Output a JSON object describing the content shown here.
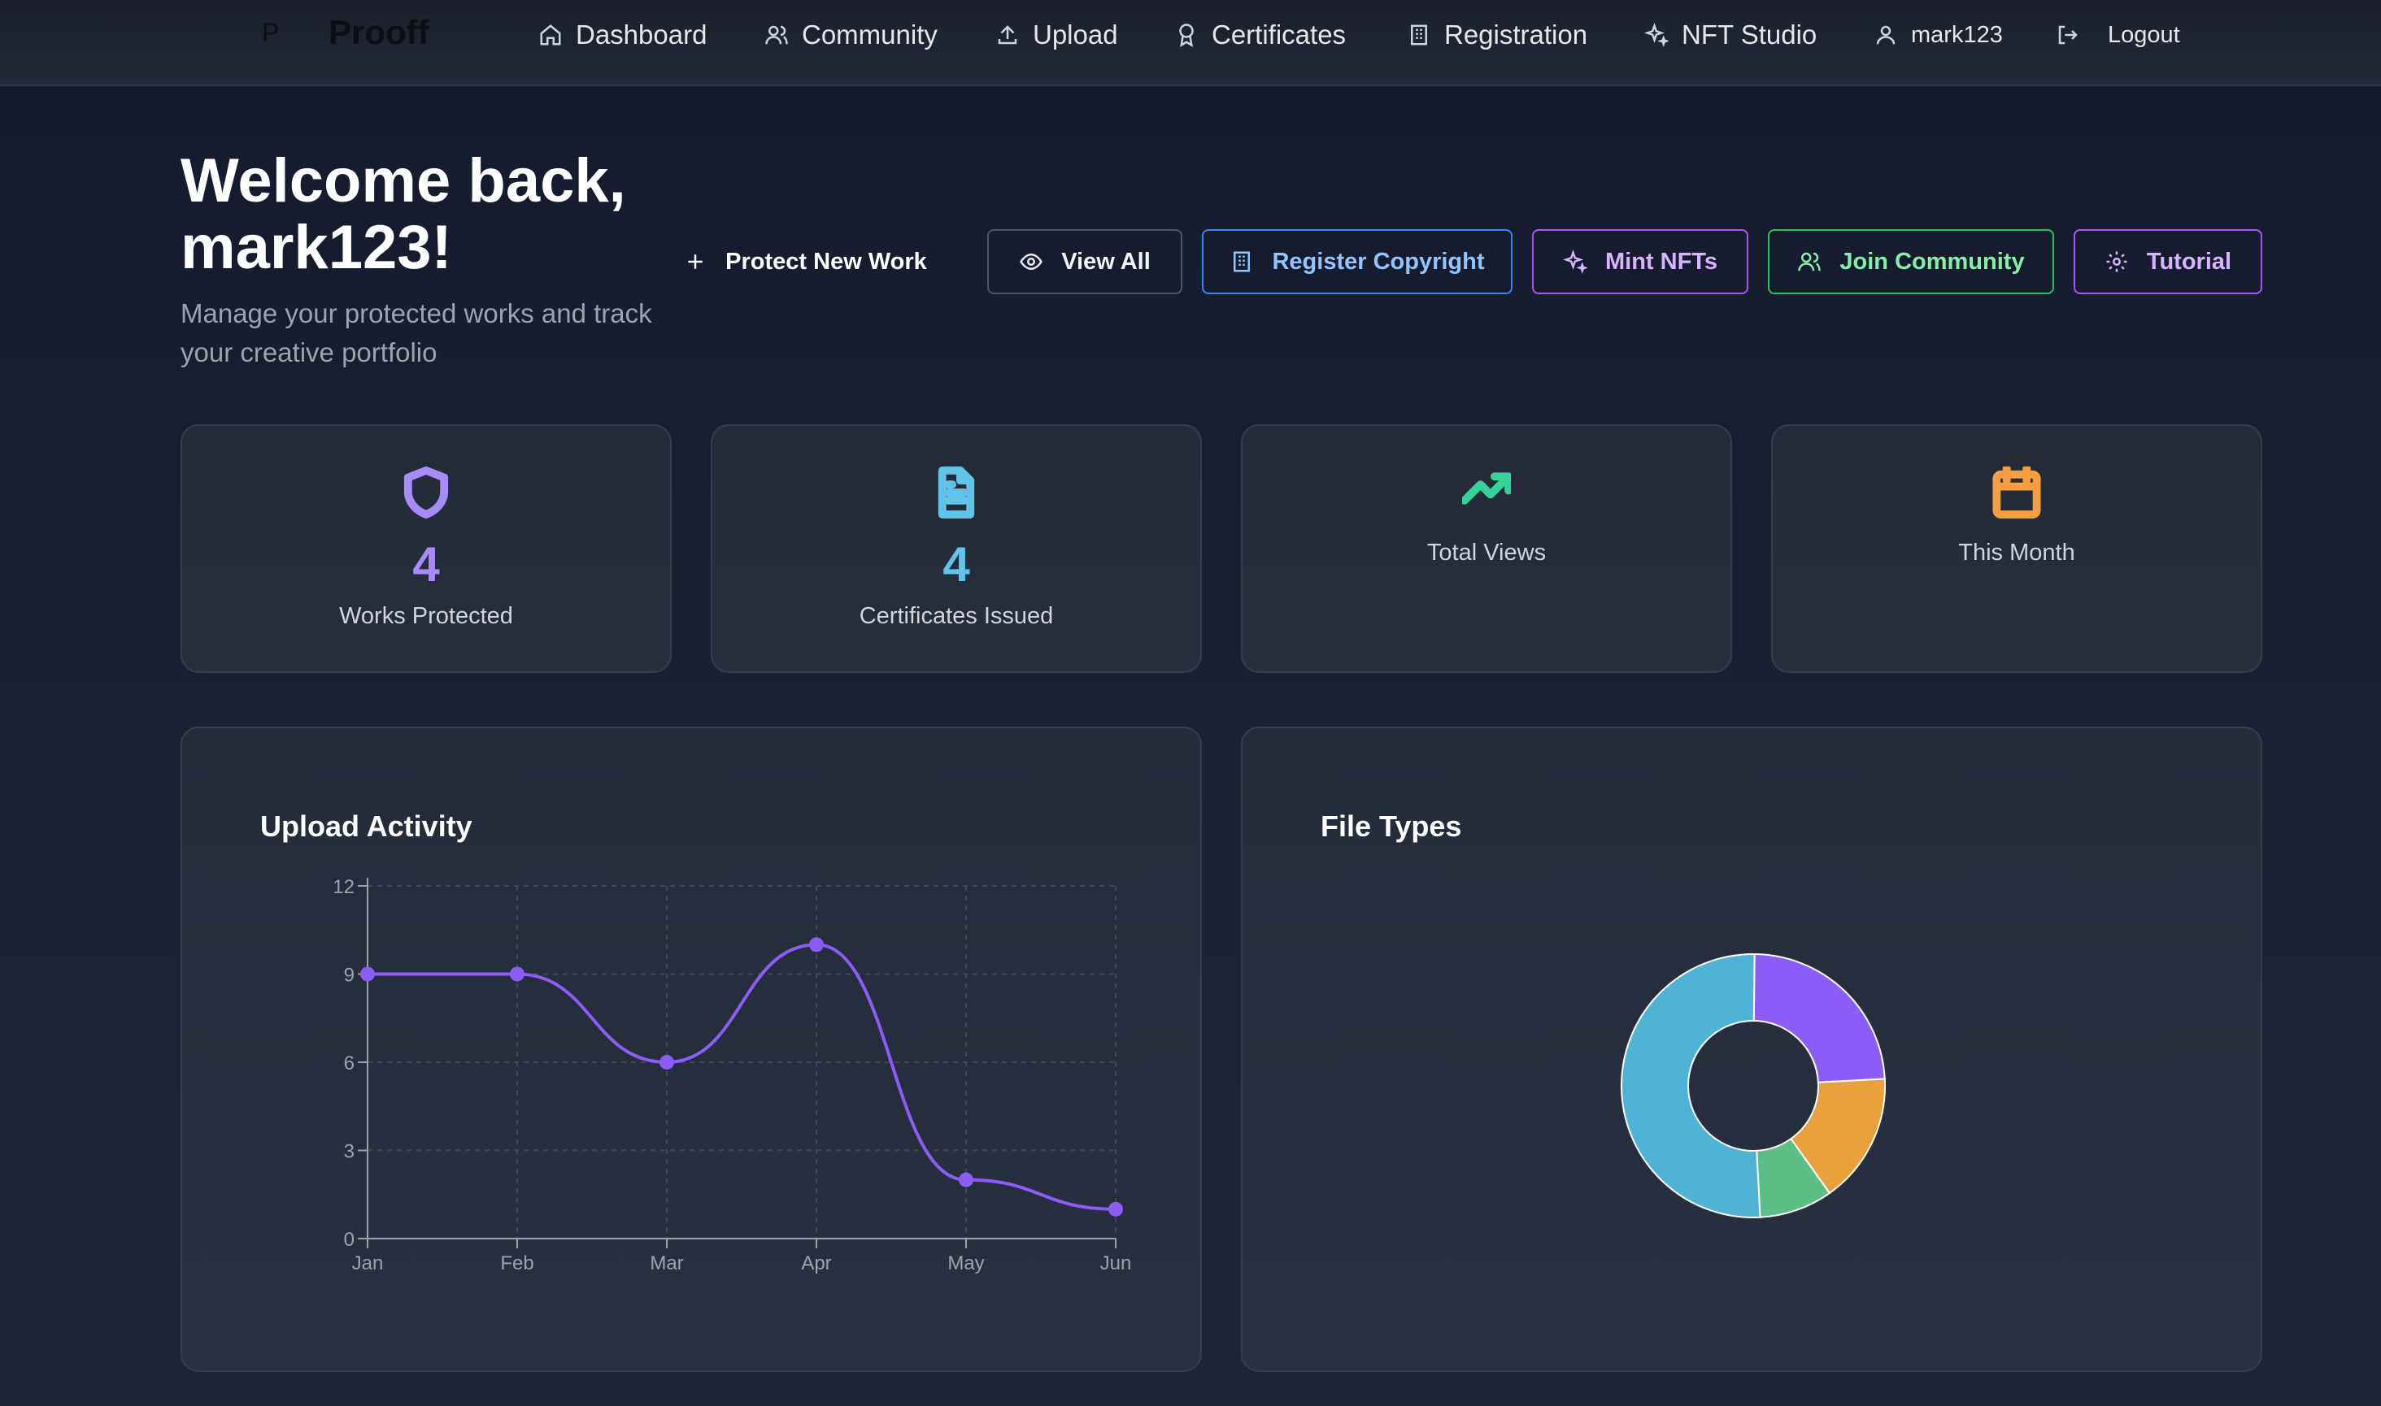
{
  "nav": {
    "logo_mark": "P",
    "logo_text": "Prooff",
    "items": [
      "Dashboard",
      "Community",
      "Upload",
      "Certificates",
      "Registration",
      "NFT Studio"
    ],
    "user": "mark123",
    "logout": "Logout"
  },
  "header": {
    "welcome": "Welcome back, mark123!",
    "subtitle": "Manage your protected works and track your creative portfolio"
  },
  "actions": {
    "protect": "Protect New Work",
    "view_all": "View All",
    "register": "Register Copyright",
    "mint": "Mint NFTs",
    "join": "Join Community",
    "tutorial": "Tutorial"
  },
  "stats": [
    {
      "icon": "shield-icon",
      "value": "4",
      "label": "Works Protected",
      "color": "#a78bfa"
    },
    {
      "icon": "document-icon",
      "value": "4",
      "label": "Certificates Issued",
      "color": "#60c3e8"
    },
    {
      "icon": "trending-up-icon",
      "value": "",
      "label": "Total Views",
      "color": "#34d399"
    },
    {
      "icon": "calendar-icon",
      "value": "",
      "label": "This Month",
      "color": "#f59e42"
    }
  ],
  "chart_data": [
    {
      "type": "line",
      "title": "Upload Activity",
      "x": [
        "Jan",
        "Feb",
        "Mar",
        "Apr",
        "May",
        "Jun"
      ],
      "series": [
        {
          "values": [
            9,
            9,
            6,
            10,
            2,
            1
          ],
          "color": "#8b5cf6"
        }
      ],
      "ylim": [
        0,
        12
      ],
      "yticks": [
        0,
        3,
        6,
        9,
        12
      ],
      "grid": true
    },
    {
      "type": "pie",
      "title": "File Types",
      "donut": true,
      "slices": [
        {
          "value": 24,
          "color": "#8b5cf6"
        },
        {
          "value": 16,
          "color": "#e9a23b"
        },
        {
          "value": 9,
          "color": "#5bbf86"
        },
        {
          "value": 51,
          "color": "#4fb3d6"
        }
      ]
    }
  ]
}
